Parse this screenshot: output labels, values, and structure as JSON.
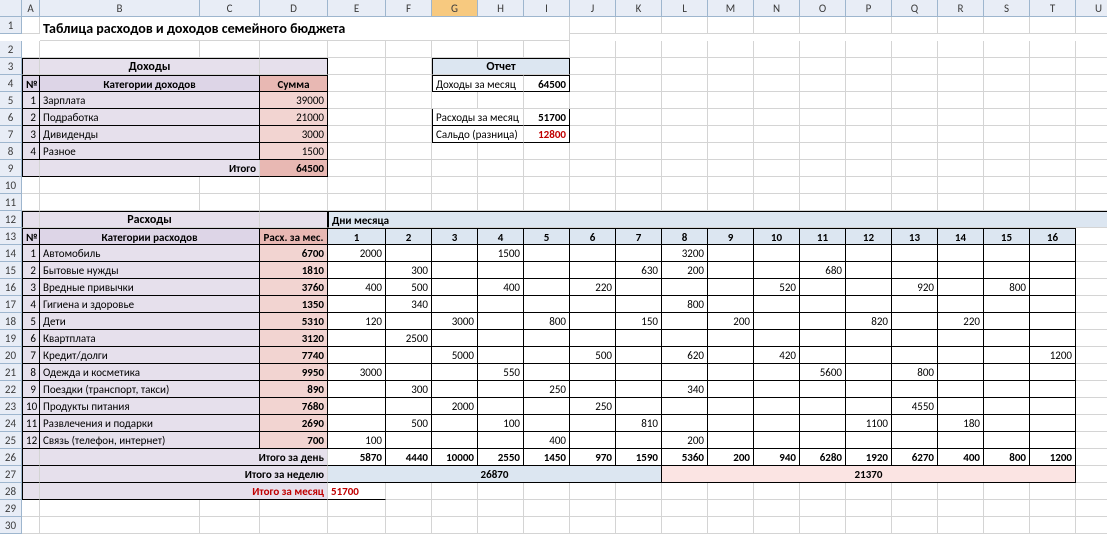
{
  "columns": [
    "A",
    "B",
    "C",
    "D",
    "E",
    "F",
    "G",
    "H",
    "I",
    "J",
    "K",
    "L",
    "M",
    "N",
    "O",
    "P",
    "Q",
    "R",
    "S",
    "T",
    "U"
  ],
  "selected_col": "G",
  "title": "Таблица расходов и доходов семейного бюджета",
  "income": {
    "header": "Доходы",
    "col_no": "№",
    "col_cat": "Категории доходов",
    "col_sum": "Сумма",
    "rows": [
      {
        "n": 1,
        "cat": "Зарплата",
        "sum": 39000
      },
      {
        "n": 2,
        "cat": "Подработка",
        "sum": 21000
      },
      {
        "n": 3,
        "cat": "Дивиденды",
        "sum": 3000
      },
      {
        "n": 4,
        "cat": "Разное",
        "sum": 1500
      }
    ],
    "total_label": "Итого",
    "total": 64500
  },
  "report": {
    "header": "Отчет",
    "rows": [
      {
        "label": "Доходы за месяц",
        "val": 64500
      },
      {
        "label": "Расходы за месяц",
        "val": 51700
      },
      {
        "label": "Сальдо (разница)",
        "val": 12800,
        "red": true
      }
    ]
  },
  "expenses": {
    "header": "Расходы",
    "days_header": "Дни месяца",
    "col_no": "№",
    "col_cat": "Категории расходов",
    "col_month": "Расх. за мес.",
    "days": [
      1,
      2,
      3,
      4,
      5,
      6,
      7,
      8,
      9,
      10,
      11,
      12,
      13,
      14,
      15,
      16
    ],
    "rows": [
      {
        "n": 1,
        "cat": "Автомобиль",
        "m": 6700,
        "d": [
          2000,
          "",
          "",
          1500,
          "",
          "",
          "",
          3200,
          "",
          "",
          "",
          "",
          "",
          "",
          "",
          ""
        ]
      },
      {
        "n": 2,
        "cat": "Бытовые нужды",
        "m": 1810,
        "d": [
          "",
          300,
          "",
          "",
          "",
          "",
          630,
          200,
          "",
          "",
          680,
          "",
          "",
          "",
          "",
          ""
        ]
      },
      {
        "n": 3,
        "cat": "Вредные привычки",
        "m": 3760,
        "d": [
          400,
          500,
          "",
          400,
          "",
          220,
          "",
          "",
          "",
          520,
          "",
          "",
          920,
          "",
          800,
          ""
        ]
      },
      {
        "n": 4,
        "cat": "Гигиена и здоровье",
        "m": 1350,
        "d": [
          "",
          340,
          "",
          "",
          "",
          "",
          "",
          800,
          "",
          "",
          "",
          "",
          "",
          "",
          "",
          ""
        ]
      },
      {
        "n": 5,
        "cat": "Дети",
        "m": 5310,
        "d": [
          120,
          "",
          3000,
          "",
          800,
          "",
          150,
          "",
          200,
          "",
          "",
          820,
          "",
          220,
          "",
          ""
        ]
      },
      {
        "n": 6,
        "cat": "Квартплата",
        "m": 3120,
        "d": [
          "",
          2500,
          "",
          "",
          "",
          "",
          "",
          "",
          "",
          "",
          "",
          "",
          "",
          "",
          "",
          ""
        ]
      },
      {
        "n": 7,
        "cat": "Кредит/долги",
        "m": 7740,
        "d": [
          "",
          "",
          5000,
          "",
          "",
          500,
          "",
          620,
          "",
          420,
          "",
          "",
          "",
          "",
          "",
          1200
        ]
      },
      {
        "n": 8,
        "cat": "Одежда и косметика",
        "m": 9950,
        "d": [
          3000,
          "",
          "",
          550,
          "",
          "",
          "",
          "",
          "",
          "",
          5600,
          "",
          800,
          "",
          "",
          ""
        ]
      },
      {
        "n": 9,
        "cat": "Поездки (транспорт, такси)",
        "m": 890,
        "d": [
          "",
          300,
          "",
          "",
          250,
          "",
          "",
          340,
          "",
          "",
          "",
          "",
          "",
          "",
          "",
          ""
        ]
      },
      {
        "n": 10,
        "cat": "Продукты питания",
        "m": 7680,
        "d": [
          "",
          "",
          2000,
          "",
          "",
          250,
          "",
          "",
          "",
          "",
          "",
          "",
          4550,
          "",
          "",
          ""
        ]
      },
      {
        "n": 11,
        "cat": "Развлечения и подарки",
        "m": 2690,
        "d": [
          "",
          500,
          "",
          100,
          "",
          "",
          810,
          "",
          "",
          "",
          "",
          1100,
          "",
          180,
          "",
          ""
        ]
      },
      {
        "n": 12,
        "cat": "Связь (телефон, интернет)",
        "m": 700,
        "d": [
          100,
          "",
          "",
          "",
          400,
          "",
          "",
          200,
          "",
          "",
          "",
          "",
          "",
          "",
          "",
          ""
        ]
      }
    ],
    "day_total_label": "Итого за день",
    "day_totals": [
      5870,
      4440,
      10000,
      2550,
      1450,
      970,
      1590,
      5360,
      200,
      940,
      6280,
      1920,
      6270,
      400,
      800,
      1200
    ],
    "week_total_label": "Итого за неделю",
    "week_totals": [
      26870,
      21370
    ],
    "month_total_label": "Итого за месяц",
    "month_total": 51700
  }
}
